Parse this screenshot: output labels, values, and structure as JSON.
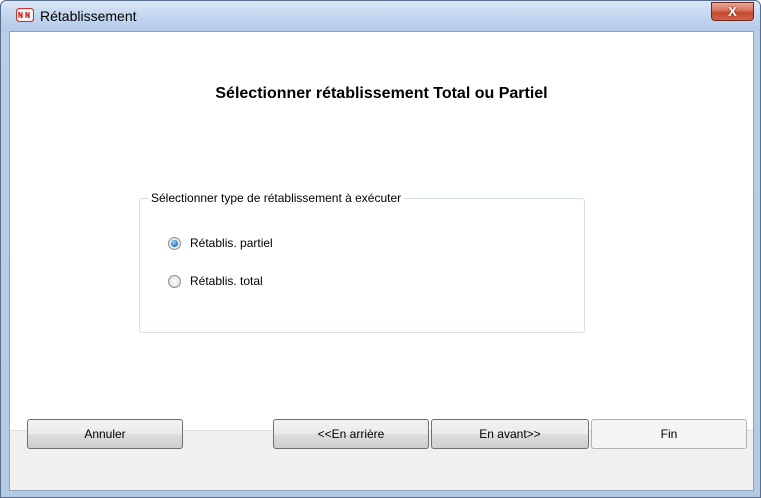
{
  "window": {
    "title": "Rétablissement",
    "close_glyph": "X",
    "icon": "nn-logo-icon"
  },
  "main": {
    "heading": "Sélectionner rétablissement Total ou Partiel",
    "group": {
      "legend": "Sélectionner type de rétablissement à exécuter",
      "options": [
        {
          "label": "Rétablis. partiel",
          "checked": true
        },
        {
          "label": "Rétablis. total",
          "checked": false
        }
      ]
    }
  },
  "buttons": {
    "cancel": "Annuler",
    "back": "<<En arrière",
    "next": "En avant>>",
    "finish": "Fin"
  },
  "colors": {
    "titlebar": "#c2d6ef",
    "close_button": "#c44a2f",
    "radio_checked": "#2f86d4"
  }
}
